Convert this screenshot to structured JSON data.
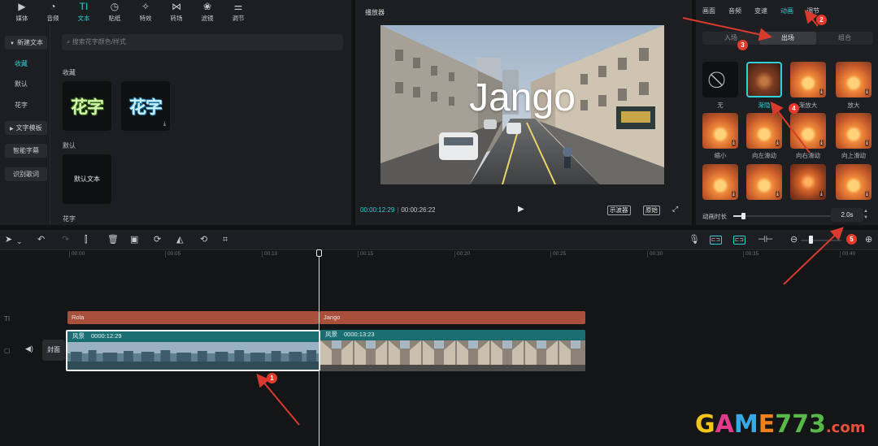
{
  "toolbar": {
    "items": [
      {
        "label": "媒体",
        "icon": "media-icon",
        "glyph": "▶"
      },
      {
        "label": "音频",
        "icon": "audio-icon",
        "glyph": "◔"
      },
      {
        "label": "文本",
        "icon": "text-icon",
        "glyph": "TI"
      },
      {
        "label": "贴纸",
        "icon": "sticker-icon",
        "glyph": "◷"
      },
      {
        "label": "特效",
        "icon": "effects-icon",
        "glyph": "✧"
      },
      {
        "label": "转场",
        "icon": "transition-icon",
        "glyph": "⋈"
      },
      {
        "label": "滤镜",
        "icon": "filter-icon",
        "glyph": "❀"
      },
      {
        "label": "调节",
        "icon": "adjust-icon",
        "glyph": "⚌"
      }
    ],
    "active_index": 2
  },
  "text_panel": {
    "sidebar": {
      "new_text": "新建文本",
      "favorites": "收藏",
      "default": "默认",
      "flower_text": "花字",
      "text_template": "文字模板",
      "smart_subtitle": "智能字幕",
      "recognize_lyrics": "识别歌词"
    },
    "search_placeholder": "搜索花字颜色/样式",
    "favorites_label": "收藏",
    "fav_tiles": [
      "花字",
      "花字"
    ],
    "default_label": "默认",
    "default_tile": "默认文本",
    "flower_label": "花字"
  },
  "player": {
    "title": "播放器",
    "overlay_text": "Jango",
    "current_time": "00:00:12:29",
    "total_time": "00:00:26:22",
    "btn_scope": "示波器",
    "btn_original": "原始"
  },
  "right_panel": {
    "tabs": [
      "画面",
      "音频",
      "变速",
      "动画",
      "调节"
    ],
    "active_tab": 3,
    "segments": [
      "入场",
      "出场",
      "组合"
    ],
    "active_segment": 1,
    "animations": [
      {
        "name": "无"
      },
      {
        "name": "渐隐"
      },
      {
        "name": "渐放大"
      },
      {
        "name": "放大"
      },
      {
        "name": "缩小"
      },
      {
        "name": "向左滑动"
      },
      {
        "name": "向右滑动"
      },
      {
        "name": "向上滑动"
      },
      {
        "name": ""
      },
      {
        "name": ""
      },
      {
        "name": ""
      },
      {
        "name": ""
      }
    ],
    "selected_animation": 1,
    "duration_label": "动画时长",
    "duration_value": "2.0s",
    "duration_fraction": 0.1
  },
  "timeline": {
    "ruler": [
      "00:00",
      "00:05",
      "00:10",
      "00:15",
      "00:20",
      "00:25",
      "00:30",
      "00:35",
      "00:40"
    ],
    "text_clips": [
      "Rola",
      "Jango"
    ],
    "cover_label": "封面",
    "video_clips": [
      {
        "label": "风景",
        "duration": "0000:12:29"
      },
      {
        "label": "风景",
        "duration": "0000:13:23"
      }
    ]
  },
  "annotations": {
    "badges": [
      "1",
      "2",
      "3",
      "4",
      "5"
    ],
    "colors": {
      "badge": "#e33a2c",
      "arrow": "#d93a2e",
      "accent": "#2fd0d6"
    }
  },
  "watermark": {
    "parts": [
      "G",
      "A",
      "M",
      "E",
      "773",
      ".com"
    ]
  }
}
